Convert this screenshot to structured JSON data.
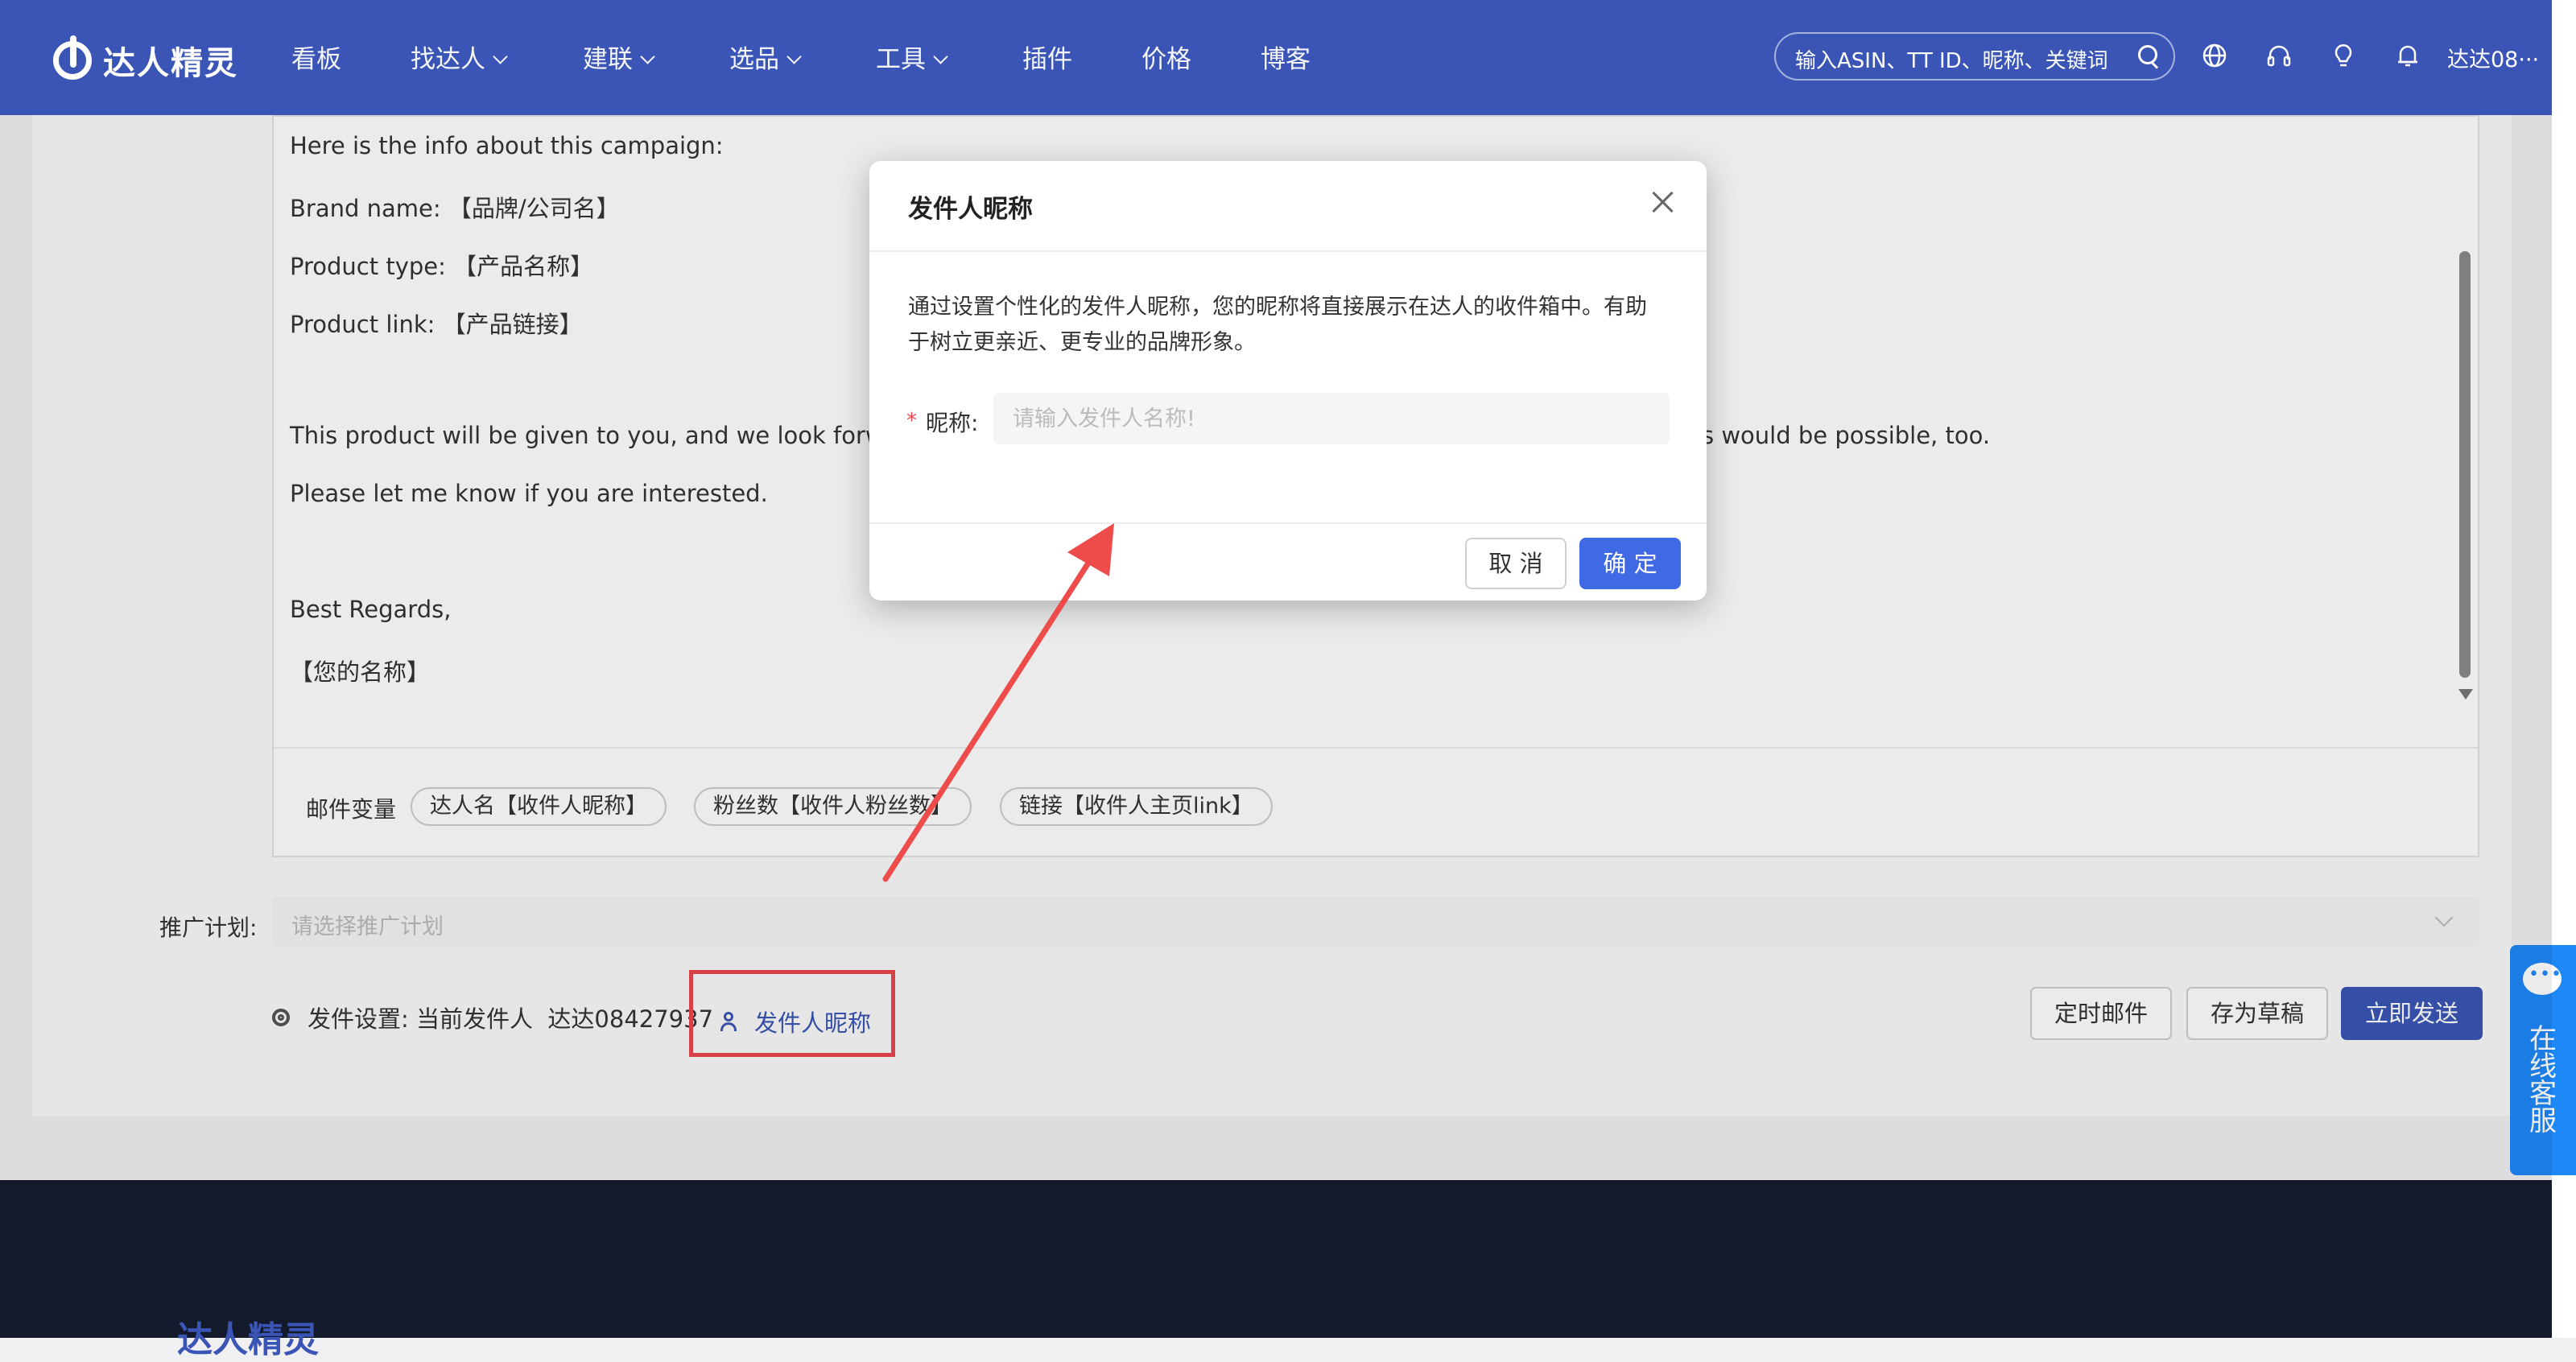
{
  "brand": {
    "name": "达人精灵"
  },
  "nav": {
    "items": [
      {
        "label": "看板",
        "dropdown": false
      },
      {
        "label": "找达人",
        "dropdown": true
      },
      {
        "label": "建联",
        "dropdown": true
      },
      {
        "label": "选品",
        "dropdown": true
      },
      {
        "label": "工具",
        "dropdown": true
      },
      {
        "label": "插件",
        "dropdown": false
      },
      {
        "label": "价格",
        "dropdown": false
      },
      {
        "label": "博客",
        "dropdown": false
      }
    ],
    "search_placeholder": "输入ASIN、TT ID、昵称、关键词",
    "user_name": "达达08···"
  },
  "editor": {
    "lines": [
      "Here is the info about this campaign:",
      "Brand name: 【品牌/公司名】",
      "Product type: 【产品名称】",
      "Product link: 【产品链接】",
      "This product will be given to you, and we look forward t",
      "s would be possible, too.",
      "Please let me know if you are interested.",
      "Best Regards,",
      "【您的名称】"
    ],
    "variables_label": "邮件变量",
    "variables": [
      "达人名【收件人昵称】",
      "粉丝数【收件人粉丝数】",
      "链接【收件人主页link】"
    ]
  },
  "plan": {
    "label": "推广计划:",
    "placeholder": "请选择推广计划"
  },
  "sender": {
    "settings_text": "发件设置: 当前发件人  达达08427937",
    "nickname_link": "发件人昵称"
  },
  "actions": {
    "schedule": "定时邮件",
    "draft": "存为草稿",
    "send": "立即发送"
  },
  "service": {
    "label": "在线客服"
  },
  "footer": {
    "brand": "达人精灵"
  },
  "modal": {
    "title": "发件人昵称",
    "description": "通过设置个性化的发件人昵称，您的昵称将直接展示在达人的收件箱中。有助于树立更亲近、更专业的品牌形象。",
    "required_mark": "*",
    "field_label": "昵称:",
    "field_placeholder": "请输入发件人名称!",
    "field_value": "",
    "cancel": "取 消",
    "confirm": "确 定"
  },
  "colors": {
    "brand_blue": "#3a55b5",
    "confirm_blue": "#4069e6",
    "highlight_red": "#e8474c",
    "service_blue": "#1e88f7"
  }
}
